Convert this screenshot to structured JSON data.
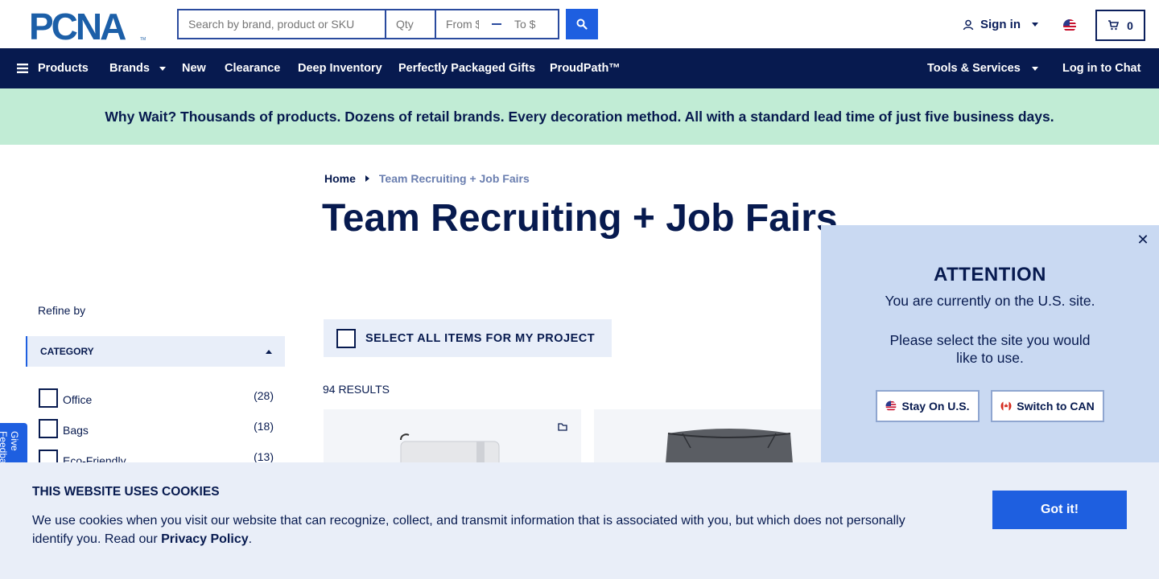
{
  "header": {
    "logo_text": "PCNA",
    "search": {
      "placeholder": "Search by brand, product or SKU",
      "value": ""
    },
    "qty": {
      "placeholder": "Qty"
    },
    "price_from": {
      "placeholder": "From $"
    },
    "price_to": {
      "placeholder": "To $"
    },
    "search_icon": "search-icon",
    "signin_label": "Sign in",
    "locale_flag": "us-flag-icon",
    "cart_count": "0"
  },
  "nav": {
    "items": [
      {
        "label": "Products",
        "icon": "menu-icon"
      },
      {
        "label": "Brands",
        "dropdown": true
      },
      {
        "label": "New"
      },
      {
        "label": "Clearance"
      },
      {
        "label": "Deep Inventory"
      },
      {
        "label": "Perfectly Packaged Gifts"
      },
      {
        "label": "ProudPath™"
      },
      {
        "label": "Tools & Services",
        "dropdown": true
      },
      {
        "label": "Log in to Chat"
      }
    ]
  },
  "promo": {
    "text": "Why Wait? Thousands of products. Dozens of retail brands. Every decoration method. All with a standard lead time of just five business days."
  },
  "breadcrumb": {
    "home": "Home",
    "current": "Team Recruiting + Job Fairs"
  },
  "page": {
    "title": "Team Recruiting + Job Fairs",
    "select_all_label": "SELECT ALL ITEMS FOR MY PROJECT",
    "results_label": "94 RESULTS"
  },
  "sidebar": {
    "refine_label": "Refine by",
    "category_header": "CATEGORY",
    "categories": [
      {
        "label": "Office",
        "count": "(28)"
      },
      {
        "label": "Bags",
        "count": "(18)"
      },
      {
        "label": "Eco-Friendly",
        "count": "(13)"
      }
    ],
    "feedback_label": "Give Feedback"
  },
  "attention": {
    "title": "ATTENTION",
    "line1": "You are currently on the U.S. site.",
    "line2": "Please select the site you would like to use.",
    "stay_label": "Stay On U.S.",
    "switch_label": "Switch to CAN",
    "close_glyph": "✕"
  },
  "cookie": {
    "title": "THIS WEBSITE USES COOKIES",
    "text": "We use cookies when you visit our website that can recognize, collect, and transmit information that is associated with you, but which does not personally identify you. Read our ",
    "link": "Privacy Policy",
    "tail": ".",
    "button": "Got it!"
  },
  "colors": {
    "navy": "#071a4f",
    "accent_blue": "#1e5fe0",
    "promo_green": "#c1ecd5",
    "popup_blue": "#c9d9f2",
    "cookie_bg": "#e9eef8"
  }
}
